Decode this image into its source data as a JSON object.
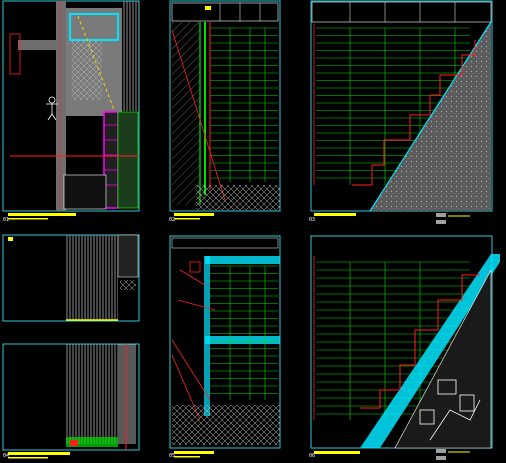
{
  "drawing": {
    "background": "#000000",
    "colors": {
      "frame": "#2fc9d8",
      "grid": "#00e000",
      "section": "#ff2020",
      "title_bar": "#ffff00",
      "hatch": "#808080",
      "detail_white": "#ffffff",
      "magenta": "#ff00ff",
      "cyan_band": "#00e5ff",
      "yellow_dash": "#f0e000"
    },
    "panels": [
      {
        "id": "p1",
        "name": "panel-plan-elevation",
        "label": "01"
      },
      {
        "id": "p2",
        "name": "panel-section-left",
        "label": "02"
      },
      {
        "id": "p3",
        "name": "panel-section-stair",
        "label": "03"
      },
      {
        "id": "p4",
        "name": "panel-facade-detail",
        "label": "04"
      },
      {
        "id": "p5",
        "name": "panel-section-joint",
        "label": "05"
      },
      {
        "id": "p6",
        "name": "panel-section-diagonal",
        "label": "06"
      }
    ]
  }
}
